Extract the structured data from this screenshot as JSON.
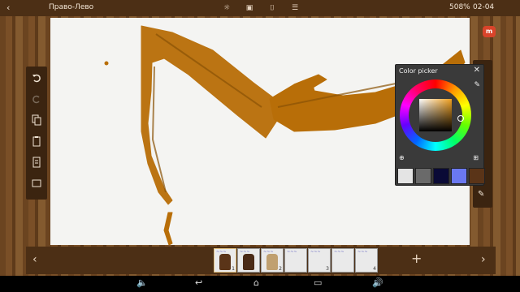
{
  "topbar": {
    "back_icon": "arrow-left-icon",
    "title": "Право-Лево",
    "tools": [
      "sun-icon",
      "layers-icon",
      "frame-icon",
      "frames-list-icon"
    ],
    "zoom": "508%",
    "frame_counter": "02-04"
  },
  "left_toolbar": [
    "undo-icon",
    "redo-icon",
    "copy-icon",
    "paste-icon",
    "copy-frame-icon",
    "blank-icon"
  ],
  "color_picker": {
    "title": "Color picker",
    "close_icon": "close-icon",
    "eyedropper_icon": "eyedropper-icon",
    "selected_color": "#f0a020",
    "swatches": [
      "#e4e4e4",
      "#6a6a6a",
      "#0a0a36",
      "#6a78f0",
      "#5a3418"
    ]
  },
  "timeline": {
    "frames": [
      {
        "number": "1",
        "fig": "#5a3418"
      },
      {
        "number": "",
        "fig": "#4a2a16"
      },
      {
        "number": "2",
        "fig": "#c0a070"
      },
      {
        "number": "",
        "fig": ""
      },
      {
        "number": "3",
        "fig": ""
      },
      {
        "number": "",
        "fig": ""
      },
      {
        "number": "4",
        "fig": ""
      }
    ],
    "add_label": "+"
  },
  "badge": {
    "label": "m"
  },
  "brush_color": "#b86e08"
}
